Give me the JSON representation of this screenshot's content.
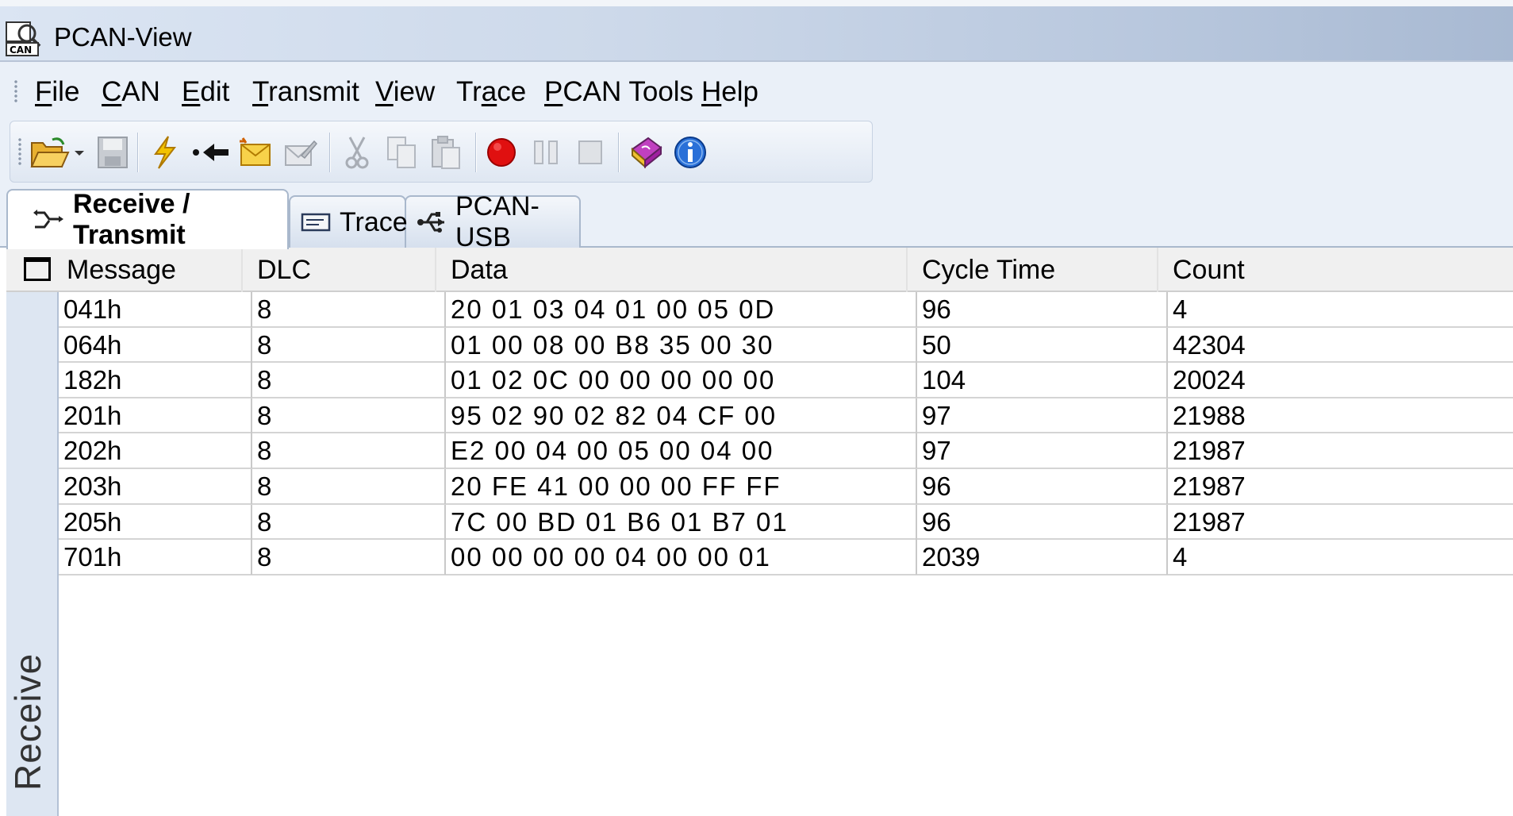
{
  "window": {
    "title": "PCAN-View"
  },
  "menu": [
    {
      "label": "File",
      "ul": "F",
      "rest": "ile"
    },
    {
      "label": "CAN",
      "ul": "C",
      "rest": "AN"
    },
    {
      "label": "Edit",
      "ul": "E",
      "rest": "dit"
    },
    {
      "label": "Transmit",
      "ul": "T",
      "rest": "ransmit"
    },
    {
      "label": "View",
      "ul": "V",
      "rest": "iew"
    },
    {
      "label": "Trace",
      "ul_pre": "Tr",
      "ul": "a",
      "rest": "ce"
    },
    {
      "label": "PCAN Tools",
      "ul": "P",
      "rest": "CAN Tools"
    },
    {
      "label": "Help",
      "ul": "H",
      "rest": "elp"
    }
  ],
  "toolbar": {
    "icons": [
      "open-folder-icon",
      "save-icon",
      "connect-lightning-icon",
      "disconnect-arrow-icon",
      "new-message-envelope-icon",
      "edit-message-icon",
      "cut-icon",
      "copy-icon",
      "paste-icon",
      "record-icon",
      "pause-icon",
      "stop-icon",
      "help-book-icon",
      "info-icon"
    ]
  },
  "tabs": [
    {
      "label": "Receive / Transmit",
      "active": true
    },
    {
      "label": "Trace",
      "active": false
    },
    {
      "label": "PCAN-USB",
      "active": false
    }
  ],
  "grid": {
    "side_label": "Receive",
    "columns": [
      "Message",
      "DLC",
      "Data",
      "Cycle Time",
      "Count"
    ],
    "rows": [
      {
        "message": "041h",
        "dlc": "8",
        "data": "20 01 03 04 01 00 05 0D",
        "cycle": "96",
        "count": "4"
      },
      {
        "message": "064h",
        "dlc": "8",
        "data": "01 00 08 00 B8 35 00 30",
        "cycle": "50",
        "count": "42304"
      },
      {
        "message": "182h",
        "dlc": "8",
        "data": "01 02 0C 00 00 00 00 00",
        "cycle": "104",
        "count": "20024"
      },
      {
        "message": "201h",
        "dlc": "8",
        "data": "95 02 90 02 82 04 CF 00",
        "cycle": "97",
        "count": "21988"
      },
      {
        "message": "202h",
        "dlc": "8",
        "data": "E2 00 04 00 05 00 04 00",
        "cycle": "97",
        "count": "21987"
      },
      {
        "message": "203h",
        "dlc": "8",
        "data": "20 FE 41 00 00 00 FF FF",
        "cycle": "96",
        "count": "21987"
      },
      {
        "message": "205h",
        "dlc": "8",
        "data": "7C 00 BD 01 B6 01 B7 01",
        "cycle": "96",
        "count": "21987"
      },
      {
        "message": "701h",
        "dlc": "8",
        "data": "00 00 00 00 04 00 00 01",
        "cycle": "2039",
        "count": "4"
      }
    ]
  }
}
